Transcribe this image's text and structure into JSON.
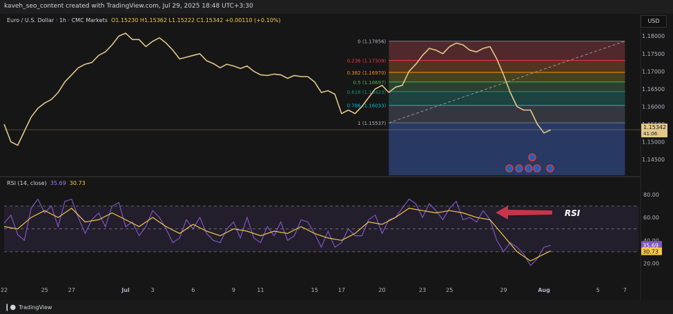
{
  "topbar": {
    "text": "kaveh_seo_content created with TradingView.com, Jul 29, 2025 18:48 UTC+3:30"
  },
  "legend": {
    "symbol": "Euro / U.S. Dollar · 1h · CMC Markets",
    "ohlc": "O1.15230 H1.15362 L1.15222 C1.15342 +0.00110 (+0.10%)"
  },
  "usd_label": "USD",
  "rsi_legend": {
    "label": "RSI (14, close)",
    "rsi_value": "35.69",
    "ma_value": "30.73"
  },
  "annotation": {
    "text": "RSI"
  },
  "footer": {
    "logo_text": "TradingView"
  },
  "colors": {
    "candle": "#e3c98a",
    "rsi_line": "#7e57c2",
    "rsi_ma": "#f7c948",
    "arrow": "#c8354a"
  },
  "chart_data": [
    {
      "type": "line",
      "name": "price",
      "ylim": [
        1.1405,
        1.182
      ],
      "price_axis_ticks": [
        "1.18000",
        "1.17500",
        "1.17000",
        "1.16500",
        "1.16000",
        "1.15500",
        "1.15000",
        "1.14500"
      ],
      "last_price": "1.15342",
      "countdown": "41:06",
      "x_ticks": [
        "22",
        "25",
        "27",
        "Jul",
        "3",
        "6",
        "9",
        "11",
        "15",
        "17",
        "20",
        "23",
        "25",
        "29",
        "Aug",
        "5",
        "7"
      ],
      "x_tick_days": [
        0,
        3,
        5,
        9,
        11,
        14,
        17,
        19,
        23,
        25,
        28,
        31,
        33,
        37,
        40,
        44,
        46
      ],
      "price_points": [
        [
          0.0,
          1.155
        ],
        [
          0.5,
          1.15
        ],
        [
          1.0,
          1.149
        ],
        [
          1.5,
          1.153
        ],
        [
          2.0,
          1.157
        ],
        [
          2.5,
          1.1595
        ],
        [
          3.0,
          1.161
        ],
        [
          3.5,
          1.162
        ],
        [
          4.0,
          1.164
        ],
        [
          4.5,
          1.167
        ],
        [
          5.0,
          1.169
        ],
        [
          5.5,
          1.171
        ],
        [
          6.0,
          1.172
        ],
        [
          6.5,
          1.1725
        ],
        [
          7.0,
          1.1745
        ],
        [
          7.5,
          1.1755
        ],
        [
          8.0,
          1.1775
        ],
        [
          8.5,
          1.18
        ],
        [
          9.0,
          1.1808
        ],
        [
          9.5,
          1.179
        ],
        [
          10.0,
          1.179
        ],
        [
          10.5,
          1.177
        ],
        [
          11.0,
          1.1785
        ],
        [
          11.5,
          1.1795
        ],
        [
          12.0,
          1.178
        ],
        [
          12.5,
          1.176
        ],
        [
          13.0,
          1.1735
        ],
        [
          13.5,
          1.174
        ],
        [
          14.0,
          1.1745
        ],
        [
          14.5,
          1.175
        ],
        [
          15.0,
          1.173
        ],
        [
          15.5,
          1.1722
        ],
        [
          16.0,
          1.171
        ],
        [
          16.5,
          1.172
        ],
        [
          17.0,
          1.1715
        ],
        [
          17.5,
          1.1708
        ],
        [
          18.0,
          1.1715
        ],
        [
          18.5,
          1.17
        ],
        [
          19.0,
          1.169
        ],
        [
          19.5,
          1.1688
        ],
        [
          20.0,
          1.1692
        ],
        [
          20.5,
          1.169
        ],
        [
          21.0,
          1.168
        ],
        [
          21.5,
          1.1688
        ],
        [
          22.0,
          1.1685
        ],
        [
          22.5,
          1.1685
        ],
        [
          23.0,
          1.167
        ],
        [
          23.5,
          1.164
        ],
        [
          24.0,
          1.1645
        ],
        [
          24.5,
          1.1635
        ],
        [
          25.0,
          1.158
        ],
        [
          25.5,
          1.159
        ],
        [
          26.0,
          1.158
        ],
        [
          26.5,
          1.16
        ],
        [
          27.0,
          1.1625
        ],
        [
          27.5,
          1.165
        ],
        [
          28.0,
          1.166
        ],
        [
          28.5,
          1.164
        ],
        [
          29.0,
          1.1655
        ],
        [
          29.5,
          1.166
        ],
        [
          30.0,
          1.17
        ],
        [
          30.5,
          1.172
        ],
        [
          31.0,
          1.1745
        ],
        [
          31.5,
          1.1765
        ],
        [
          32.0,
          1.176
        ],
        [
          32.5,
          1.175
        ],
        [
          33.0,
          1.177
        ],
        [
          33.5,
          1.178
        ],
        [
          34.0,
          1.1775
        ],
        [
          34.5,
          1.176
        ],
        [
          35.0,
          1.1755
        ],
        [
          35.5,
          1.1765
        ],
        [
          36.0,
          1.177
        ],
        [
          36.5,
          1.1735
        ],
        [
          37.0,
          1.169
        ],
        [
          37.5,
          1.164
        ],
        [
          38.0,
          1.16
        ],
        [
          38.5,
          1.159
        ],
        [
          39.0,
          1.159
        ],
        [
          39.5,
          1.155
        ],
        [
          40.0,
          1.1525
        ],
        [
          40.5,
          1.1534
        ]
      ],
      "fibonacci": {
        "levels": [
          {
            "ratio": "0",
            "price": 1.17856,
            "label": "0 (1.17856)"
          },
          {
            "ratio": "0.236",
            "price": 1.17309,
            "label": "0.236 (1.17309)"
          },
          {
            "ratio": "0.382",
            "price": 1.1697,
            "label": "0.382 (1.16970)"
          },
          {
            "ratio": "0.5",
            "price": 1.16697,
            "label": "0.5 (1.16697)"
          },
          {
            "ratio": "0.618",
            "price": 1.16423,
            "label": "0.618 (1.16423)"
          },
          {
            "ratio": "0.786",
            "price": 1.16033,
            "label": "0.786 (1.16033)"
          },
          {
            "ratio": "1",
            "price": 1.15537,
            "label": "1 (1.15537)"
          }
        ],
        "line_colors": [
          "#787b86",
          "#f23645",
          "#ff9800",
          "#4caf50",
          "#089981",
          "#00bcd4",
          "#787b86"
        ],
        "band_colors": [
          "#5c2b2f",
          "#5e3a22",
          "#4d4a24",
          "#2d4a34",
          "#1f4a48",
          "#3a3d45"
        ],
        "extension_color": "#2a3d6b",
        "start_day": 28.5,
        "end_day": 46.0
      }
    },
    {
      "type": "line",
      "name": "RSI (14, close)",
      "ylim": [
        10,
        86
      ],
      "y_ticks": [
        "80.00",
        "60.00",
        "40.00",
        "20.00"
      ],
      "bands": [
        70,
        50,
        30
      ],
      "rsi_points": [
        [
          0.0,
          55
        ],
        [
          0.5,
          62
        ],
        [
          1.0,
          45
        ],
        [
          1.5,
          40
        ],
        [
          2.0,
          68
        ],
        [
          2.5,
          76
        ],
        [
          3.0,
          64
        ],
        [
          3.5,
          70
        ],
        [
          4.0,
          52
        ],
        [
          4.5,
          74
        ],
        [
          5.0,
          76
        ],
        [
          5.5,
          60
        ],
        [
          6.0,
          46
        ],
        [
          6.5,
          58
        ],
        [
          7.0,
          64
        ],
        [
          7.5,
          52
        ],
        [
          8.0,
          70
        ],
        [
          8.5,
          73
        ],
        [
          9.0,
          52
        ],
        [
          9.5,
          56
        ],
        [
          10.0,
          44
        ],
        [
          10.5,
          52
        ],
        [
          11.0,
          66
        ],
        [
          11.5,
          60
        ],
        [
          12.0,
          50
        ],
        [
          12.5,
          38
        ],
        [
          13.0,
          42
        ],
        [
          13.5,
          58
        ],
        [
          14.0,
          50
        ],
        [
          14.5,
          60
        ],
        [
          15.0,
          46
        ],
        [
          15.5,
          40
        ],
        [
          16.0,
          38
        ],
        [
          16.5,
          50
        ],
        [
          17.0,
          56
        ],
        [
          17.5,
          42
        ],
        [
          18.0,
          60
        ],
        [
          18.5,
          42
        ],
        [
          19.0,
          38
        ],
        [
          19.5,
          52
        ],
        [
          20.0,
          44
        ],
        [
          20.5,
          56
        ],
        [
          21.0,
          40
        ],
        [
          21.5,
          44
        ],
        [
          22.0,
          58
        ],
        [
          22.5,
          56
        ],
        [
          23.0,
          46
        ],
        [
          23.5,
          34
        ],
        [
          24.0,
          48
        ],
        [
          24.5,
          34
        ],
        [
          25.0,
          38
        ],
        [
          25.5,
          50
        ],
        [
          26.0,
          44
        ],
        [
          26.5,
          44
        ],
        [
          27.0,
          58
        ],
        [
          27.5,
          62
        ],
        [
          28.0,
          46
        ],
        [
          28.5,
          58
        ],
        [
          29.0,
          60
        ],
        [
          29.5,
          68
        ],
        [
          30.0,
          76
        ],
        [
          30.5,
          72
        ],
        [
          31.0,
          60
        ],
        [
          31.5,
          72
        ],
        [
          32.0,
          66
        ],
        [
          32.5,
          58
        ],
        [
          33.0,
          68
        ],
        [
          33.5,
          74
        ],
        [
          34.0,
          58
        ],
        [
          34.5,
          60
        ],
        [
          35.0,
          56
        ],
        [
          35.5,
          66
        ],
        [
          36.0,
          58
        ],
        [
          36.5,
          40
        ],
        [
          37.0,
          30
        ],
        [
          37.5,
          38
        ],
        [
          38.0,
          34
        ],
        [
          38.5,
          28
        ],
        [
          39.0,
          18
        ],
        [
          39.5,
          24
        ],
        [
          40.0,
          34
        ],
        [
          40.5,
          35.69
        ]
      ],
      "rsi_ma_points": [
        [
          0.0,
          52
        ],
        [
          1.0,
          50
        ],
        [
          2.0,
          60
        ],
        [
          3.0,
          66
        ],
        [
          4.0,
          60
        ],
        [
          5.0,
          68
        ],
        [
          6.0,
          56
        ],
        [
          7.0,
          58
        ],
        [
          8.0,
          64
        ],
        [
          9.0,
          58
        ],
        [
          10.0,
          52
        ],
        [
          11.0,
          60
        ],
        [
          12.0,
          52
        ],
        [
          13.0,
          46
        ],
        [
          14.0,
          54
        ],
        [
          15.0,
          48
        ],
        [
          16.0,
          44
        ],
        [
          17.0,
          50
        ],
        [
          18.0,
          48
        ],
        [
          19.0,
          44
        ],
        [
          20.0,
          48
        ],
        [
          21.0,
          46
        ],
        [
          22.0,
          52
        ],
        [
          23.0,
          46
        ],
        [
          24.0,
          42
        ],
        [
          25.0,
          40
        ],
        [
          26.0,
          46
        ],
        [
          27.0,
          56
        ],
        [
          28.0,
          54
        ],
        [
          29.0,
          60
        ],
        [
          30.0,
          68
        ],
        [
          31.0,
          66
        ],
        [
          32.0,
          64
        ],
        [
          33.0,
          66
        ],
        [
          34.0,
          64
        ],
        [
          35.0,
          60
        ],
        [
          36.0,
          58
        ],
        [
          37.0,
          44
        ],
        [
          38.0,
          30
        ],
        [
          39.0,
          22
        ],
        [
          40.0,
          28
        ],
        [
          40.5,
          30.73
        ]
      ]
    }
  ]
}
